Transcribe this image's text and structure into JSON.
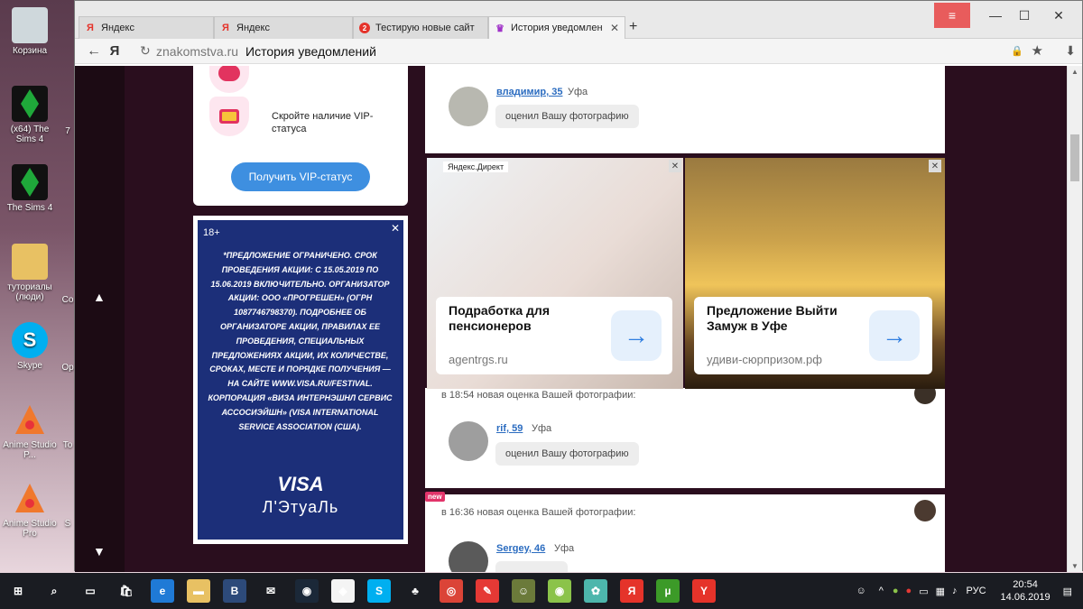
{
  "desktop": {
    "icons": [
      {
        "label": "Корзина",
        "icon": "recycle-bin-icon",
        "color": "#cfd8dc"
      },
      {
        "label": "(x64) The Sims 4",
        "icon": "sims-plumbob-icon",
        "color": "#1fa83a"
      },
      {
        "label": "The Sims 4",
        "icon": "sims-plumbob-icon",
        "color": "#1fa83a"
      },
      {
        "label": "туториалы (люди)",
        "icon": "folder-icon",
        "color": "#e8c163"
      },
      {
        "label": "Skype",
        "icon": "skype-icon",
        "color": "#00aff0"
      },
      {
        "label": "Anime Studio P...",
        "icon": "anime-studio-icon",
        "color": "#f0782d"
      },
      {
        "label": "Anime Studio Pro",
        "icon": "anime-studio-icon",
        "color": "#f0782d"
      }
    ],
    "partial_labels": [
      "7",
      "Co",
      "Op",
      "To",
      "S"
    ]
  },
  "browser": {
    "tabs": [
      {
        "label": "Яндекс",
        "favicon": "Я",
        "favicon_color": "#e5332a",
        "active": false
      },
      {
        "label": "Яндекс",
        "favicon": "Я",
        "favicon_color": "#e5332a",
        "active": false
      },
      {
        "label": "Тестирую новые сайт",
        "favicon": "●",
        "favicon_color": "#e5332a",
        "active": false
      },
      {
        "label": "История уведомлен",
        "favicon": "♛",
        "favicon_color": "#a033c8",
        "active": true
      }
    ],
    "new_tab": "+",
    "address": {
      "domain": "znakomstva.ru",
      "page_title": "История уведомлений"
    },
    "window_buttons": {
      "menu": "≡",
      "minimize": "—",
      "maximize": "☐",
      "close": "✕"
    }
  },
  "page": {
    "vip": {
      "text": "Скройте наличие VIP-статуса",
      "button": "Получить VIP-статус"
    },
    "visa_ad": {
      "age": "18+",
      "close": "✕",
      "text": "*ПРЕДЛОЖЕНИЕ ОГРАНИЧЕНО. СРОК ПРОВЕДЕНИЯ АКЦИИ: С 15.05.2019 ПО 15.06.2019 ВКЛЮЧИТЕЛЬНО. ОРГАНИЗАТОР АКЦИИ: ООО «ПРОГРЕШЕН» (ОГРН 1087746798370). ПОДРОБНЕЕ ОБ ОРГАНИЗАТОРЕ АКЦИИ, ПРАВИЛАХ ЕЕ ПРОВЕДЕНИЯ, СПЕЦИАЛЬНЫХ ПРЕДЛОЖЕНИЯХ АКЦИИ, ИХ КОЛИЧЕСТВЕ, СРОКАХ, МЕСТЕ И ПОРЯДКЕ ПОЛУЧЕНИЯ — НА САЙТЕ WWW.VISA.RU/FESTIVAL. КОРПОРАЦИЯ «ВИЗА ИНТЕРНЭШНЛ СЕРВИС АССОСИЭЙШН» (VISA INTERNATIONAL SERVICE ASSOCIATION (США).",
      "brand1": "VISA",
      "brand2": "Л'ЭтуаЛь"
    },
    "notifications": [
      {
        "user": "владимир, 35",
        "city": "Уфа",
        "action": "оценил Вашу фотографию"
      },
      {
        "header": "в 18:54 новая оценка Вашей фотографии:",
        "user": "rif, 59",
        "city": "Уфа",
        "action": "оценил Вашу фотографию"
      },
      {
        "header": "в 16:36 новая оценка Вашей фотографии:",
        "user": "Sergey, 46",
        "city": "Уфа",
        "badge": "new"
      }
    ],
    "ads": [
      {
        "label": "Яндекс.Директ",
        "title": "Подработка для пенсионеров",
        "domain": "agentrgs.ru"
      },
      {
        "title": "Предложение Выйти Замуж в Уфе",
        "domain": "удиви-сюрпризом.рф"
      }
    ]
  },
  "taskbar": {
    "icons": [
      {
        "name": "windows-start-icon",
        "glyph": "⊞",
        "color": "#1a1c22"
      },
      {
        "name": "search-icon",
        "glyph": "⌕",
        "color": "#1a1c22"
      },
      {
        "name": "task-view-icon",
        "glyph": "▭",
        "color": "#1a1c22"
      },
      {
        "name": "store-icon",
        "glyph": "🛍",
        "color": "#1a1c22"
      },
      {
        "name": "edge-icon",
        "glyph": "e",
        "color": "#1f7ad6"
      },
      {
        "name": "file-explorer-icon",
        "glyph": "▬",
        "color": "#e8c163"
      },
      {
        "name": "b-app-icon",
        "glyph": "B",
        "color": "#2d4a7a"
      },
      {
        "name": "mail-icon",
        "glyph": "✉",
        "color": "#1a1c22"
      },
      {
        "name": "steam-icon",
        "glyph": "◉",
        "color": "#1b2838"
      },
      {
        "name": "colorful-app-icon",
        "glyph": "◈",
        "color": "#f4f4f4"
      },
      {
        "name": "skype-icon",
        "glyph": "S",
        "color": "#00aff0"
      },
      {
        "name": "game-icon",
        "glyph": "♣",
        "color": "#1a1c22"
      },
      {
        "name": "chrome-icon",
        "glyph": "◎",
        "color": "#db4437"
      },
      {
        "name": "pin-app-icon",
        "glyph": "✎",
        "color": "#e53935"
      },
      {
        "name": "avatar-app-icon",
        "glyph": "☺",
        "color": "#6b7a3a"
      },
      {
        "name": "ball-icon",
        "glyph": "◉",
        "color": "#8bc34a"
      },
      {
        "name": "anime-app-icon",
        "glyph": "✿",
        "color": "#4db6ac"
      },
      {
        "name": "yandex-icon",
        "glyph": "Я",
        "color": "#e5332a"
      },
      {
        "name": "utorrent-icon",
        "glyph": "µ",
        "color": "#3c9a28"
      },
      {
        "name": "yandex-browser-icon",
        "glyph": "Y",
        "color": "#e5332a"
      }
    ],
    "tray": {
      "lang": "РУС",
      "time": "20:54",
      "date": "14.06.2019"
    }
  }
}
